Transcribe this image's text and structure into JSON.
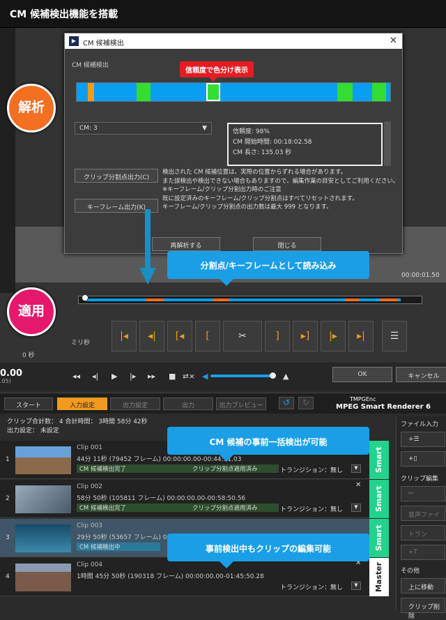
{
  "page_title": "CM 候補検出機能を搭載",
  "dialog": {
    "title": "CM 候補検出",
    "section_label": "CM 候補検出",
    "reliability_callout": "信頼度で色分け表示",
    "select_value": "CM: 3",
    "info": {
      "reliability": "信頼度: 98%",
      "start_time": "CM 開始時間: 00:18:02.58",
      "length": "CM 長さ: 135.03 秒"
    },
    "clip_split_button": "クリップ分割点出力(C)",
    "keyframe_button": "キーフレーム出力(K)",
    "notice": [
      "検出された CM 候補位置は、実際の位置からずれる場合があります。",
      "また誤検出や検出できない場合もありますので、編集作業の目安としてご利用ください。",
      "※キーフレーム/クリップ分割出力時のご注意",
      "既に設定済みのキーフレーム/クリップ分割点はすべてリセットされます。",
      "キーフレーム/クリップ分割点の出力数は最大 999 となります。"
    ],
    "reanalyze_button": "再解析する",
    "close_button": "閉じる"
  },
  "badges": {
    "analyze": "解析",
    "apply": "適用"
  },
  "callouts": {
    "apply": "分割点/キーフレームとして読み込み",
    "cm_detect": "CM 候補の事前一括検出が可能",
    "edit_during": "事前検出中もクリップの編集可能"
  },
  "editor": {
    "timecode_right": "00:00:01.50",
    "ms_label": "ミリ秒",
    "sec_label": "0 秒",
    "time_left": "0.00",
    "time_left_sub": ".05)",
    "ok": "OK",
    "cancel": "キャンセル"
  },
  "app": {
    "steps": [
      "スタート",
      "入力設定",
      "出力設定",
      "出力",
      "出力プレビュー"
    ],
    "product_line1": "TMPGEnc",
    "product_line2": "MPEG Smart Renderer 6",
    "summary_line1": "クリップ合計数：  4   合計時間：   3時間 58分 42秒",
    "summary_line2": "出力設定：  未設定"
  },
  "clips": [
    {
      "num": "1",
      "name": "Clip 001",
      "dur": "44分 11秒 (79452 フレーム)  00:00:00.00-00:44:11.03",
      "status": "CM 候補検出完了",
      "split": "クリップ分割点適用済み",
      "trans": "トランジション：無し",
      "tab": "Smart",
      "thumb": "#8a6a4a"
    },
    {
      "num": "2",
      "name": "Clip 002",
      "dur": "58分 50秒 (105811 フレーム)  00:00:00.00-00:58:50.56",
      "status": "CM 候補検出完了",
      "split": "クリップ分割点適用済み",
      "trans": "トランジション：無し",
      "tab": "Smart",
      "thumb": "#6a7f8a"
    },
    {
      "num": "3",
      "name": "Clip 003",
      "dur": "29分 50秒 (53657 フレーム)  00:00:00.00-00:29:50.90",
      "status": "CM 候補検出中",
      "split": "",
      "trans": "トランジション：無し",
      "tab": "Smart",
      "thumb": "#2a6a8a"
    },
    {
      "num": "4",
      "name": "Clip 004",
      "dur": "1時間 45分 50秒 (190318 フレーム)  00:00:00.00-01:45:50.28",
      "status": "",
      "split": "",
      "trans": "トランジション：無し",
      "tab": "Master",
      "thumb": "#7a5a4a"
    }
  ],
  "right_panel": {
    "file_input": "ファイル入力",
    "clip_edit": "クリップ編集",
    "other": "その他",
    "move_up": "上に移動",
    "delete_clip": "クリップ削除",
    "audio": "音声ファイ",
    "trans": "トラン"
  },
  "colors": {
    "accent_orange": "#f29a1e",
    "accent_blue": "#1a9ee6",
    "cm_orange": "#f26b1d",
    "cm_green": "#33dd33"
  }
}
